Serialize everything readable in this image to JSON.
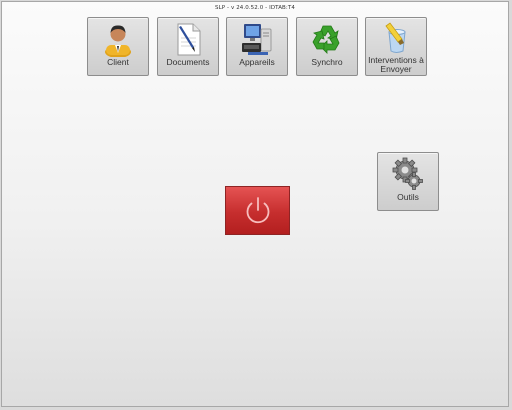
{
  "window": {
    "title": "SLP - v 24.0.52.0 - IDTAB:T4"
  },
  "toolbar": {
    "client": {
      "label": "Client",
      "icon": "person-icon"
    },
    "documents": {
      "label": "Documents",
      "icon": "document-pen-icon"
    },
    "appareils": {
      "label": "Appareils",
      "icon": "computer-icon"
    },
    "synchro": {
      "label": "Synchro",
      "icon": "recycle-icon"
    },
    "interventions": {
      "label_line1": "Interventions à",
      "label_line2": "Envoyer",
      "icon": "paint-bucket-icon"
    }
  },
  "tools": {
    "outils": {
      "label": "Outils",
      "icon": "gear-icon"
    }
  },
  "power": {
    "icon": "power-icon"
  },
  "colors": {
    "power_red": "#c62e2e",
    "tile_gray": "#d6d6d6",
    "recycle_green": "#3aa12b"
  }
}
